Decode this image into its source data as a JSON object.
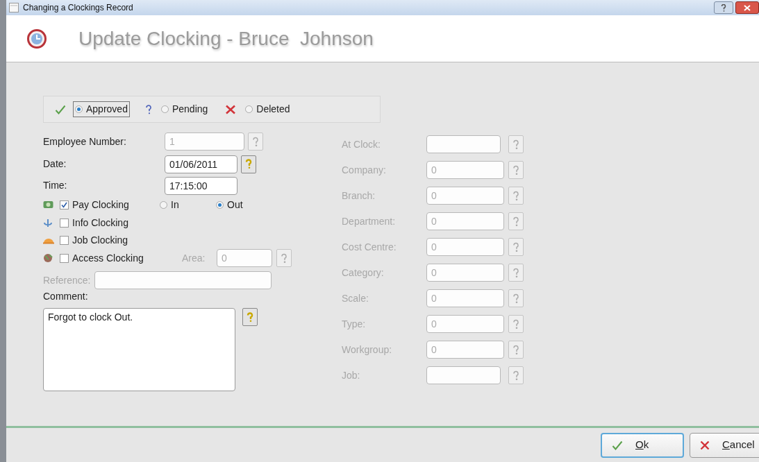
{
  "window": {
    "title": "Changing a Clockings Record"
  },
  "header": {
    "title": "Update Clocking - Bruce  Johnson"
  },
  "status_options": [
    {
      "label": "Approved",
      "kind": "approved",
      "selected": true
    },
    {
      "label": "Pending",
      "kind": "pending",
      "selected": false
    },
    {
      "label": "Deleted",
      "kind": "deleted",
      "selected": false
    }
  ],
  "fields": [
    {
      "label": "Employee Number:",
      "value": "1",
      "disabled": true,
      "help": true
    },
    {
      "label": "Date:",
      "value": "01/06/2011",
      "disabled": false,
      "help": true
    },
    {
      "label": "Time:",
      "value": "17:15:00",
      "disabled": false,
      "help": false
    }
  ],
  "clocking_types": [
    {
      "label": "Pay Clocking",
      "kind": "pay",
      "checked": true
    },
    {
      "label": "Info Clocking",
      "kind": "info",
      "checked": false
    },
    {
      "label": "Job Clocking",
      "kind": "job",
      "checked": false
    },
    {
      "label": "Access Clocking",
      "kind": "access",
      "checked": false
    }
  ],
  "direction": [
    {
      "label": "In",
      "selected": false
    },
    {
      "label": "Out",
      "selected": true
    }
  ],
  "area": {
    "label": "Area:",
    "value": "0",
    "disabled": true
  },
  "reference": {
    "label": "Reference:",
    "disabled": true
  },
  "comment": {
    "label": "Comment:",
    "value": "Forgot to clock Out.",
    "disabled": false
  },
  "right_fields": [
    {
      "label": "At Clock:",
      "disabled": true
    },
    {
      "label": "Company:",
      "value": "0",
      "disabled": true
    },
    {
      "label": "Branch:",
      "value": "0",
      "disabled": true
    },
    {
      "label": "Department:",
      "value": "0",
      "disabled": true
    },
    {
      "label": "Cost Centre:",
      "value": "0",
      "disabled": true
    },
    {
      "label": "Category:",
      "value": "0",
      "disabled": true
    },
    {
      "label": "Scale:",
      "value": "0",
      "disabled": true
    },
    {
      "label": "Type:",
      "value": "0",
      "disabled": true
    },
    {
      "label": "Workgroup:",
      "value": "0",
      "disabled": true
    },
    {
      "label": "Job:",
      "disabled": true
    }
  ],
  "buttons": [
    {
      "label": "Ok",
      "kind": "ok",
      "default": true
    },
    {
      "label": "Cancel",
      "kind": "cancel",
      "default": false
    }
  ]
}
